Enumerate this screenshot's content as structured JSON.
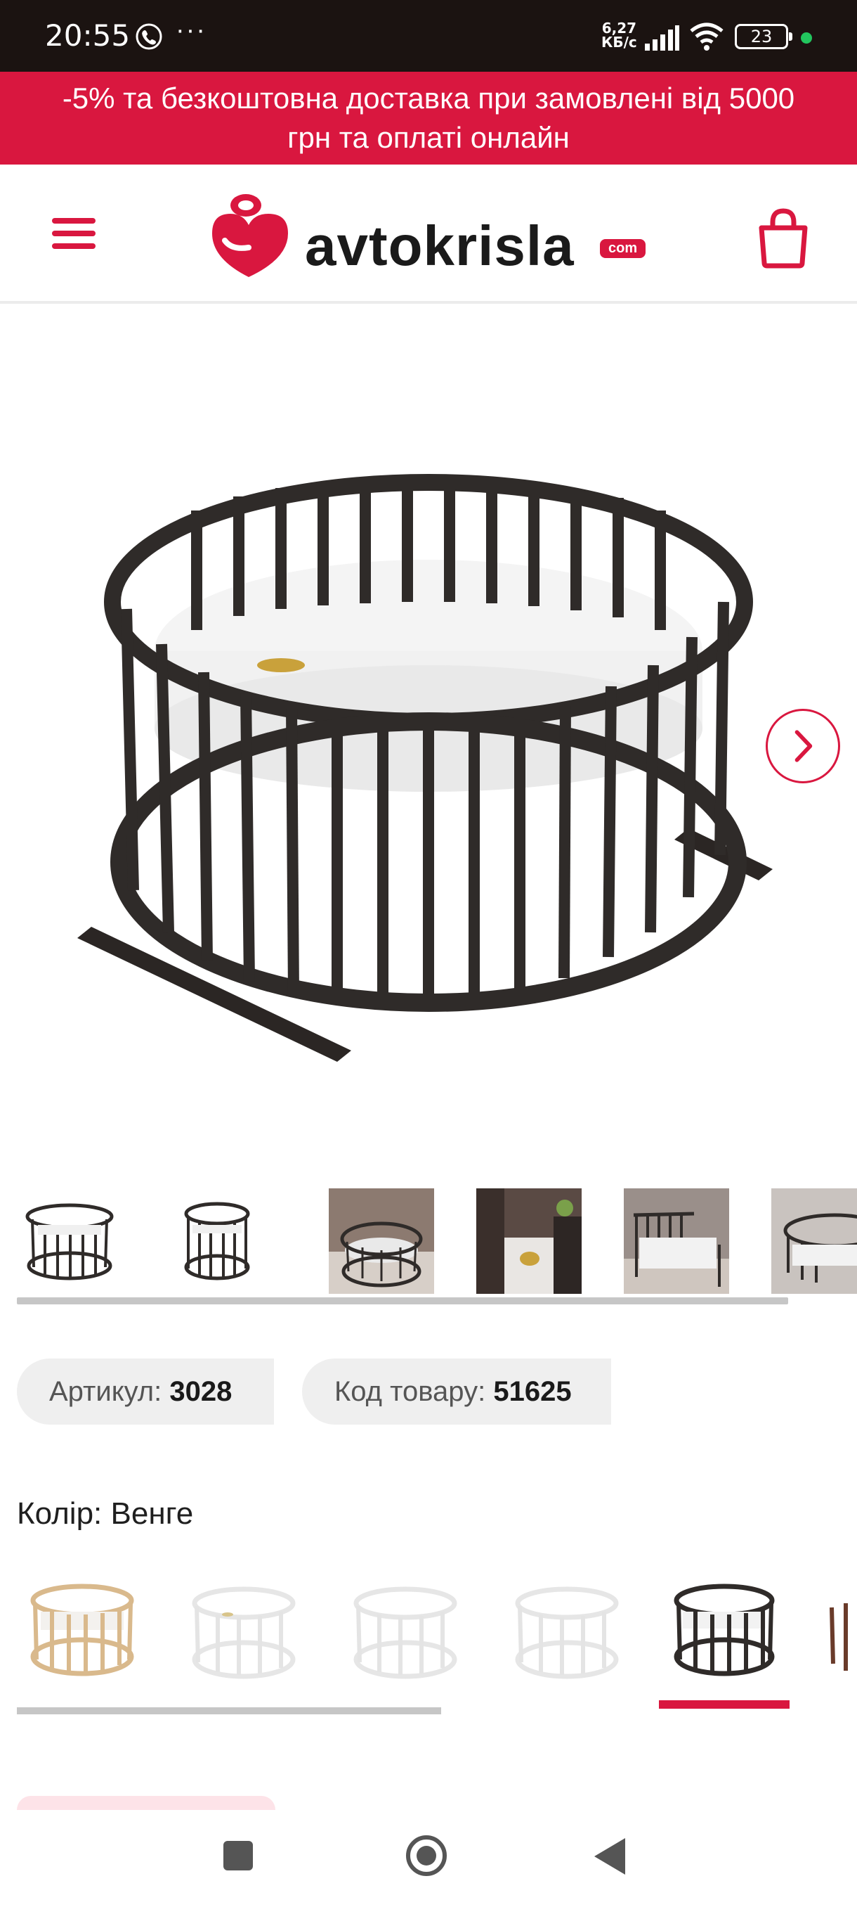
{
  "status_bar": {
    "time": "20:55",
    "more": "···",
    "net_speed_value": "6,27",
    "net_speed_unit": "КБ/с",
    "battery": "23",
    "icons": [
      "viber-icon",
      "signal-icon",
      "wifi-icon",
      "battery-icon"
    ]
  },
  "promo": {
    "line1": "-5% та безкоштовна доставка при замовлені від 5000",
    "line2": "грн та оплаті онлайн"
  },
  "header": {
    "logo_text": "avtokrisla",
    "logo_badge": "com",
    "icons": [
      "menu-icon",
      "cart-icon"
    ]
  },
  "gallery": {
    "next_icon": "chevron-right-icon",
    "thumbnail_count": 6
  },
  "product": {
    "article_label": "Артикул:",
    "article_value": "3028",
    "code_label": "Код товару:",
    "code_value": "51625",
    "color_label": "Колір:",
    "color_value": "Венге",
    "swatches": [
      {
        "color": "natural",
        "fill": "#d9b98c"
      },
      {
        "color": "white",
        "fill": "#f2f2f2"
      },
      {
        "color": "white",
        "fill": "#f2f2f2"
      },
      {
        "color": "white",
        "fill": "#f2f2f2"
      },
      {
        "color": "wenge",
        "fill": "#2f2b29",
        "selected": true
      },
      {
        "color": "brown",
        "fill": "#6a3b2a"
      }
    ]
  },
  "colors": {
    "accent": "#d9173f",
    "status_bar": "#1b1311",
    "wenge": "#2f2b29"
  }
}
